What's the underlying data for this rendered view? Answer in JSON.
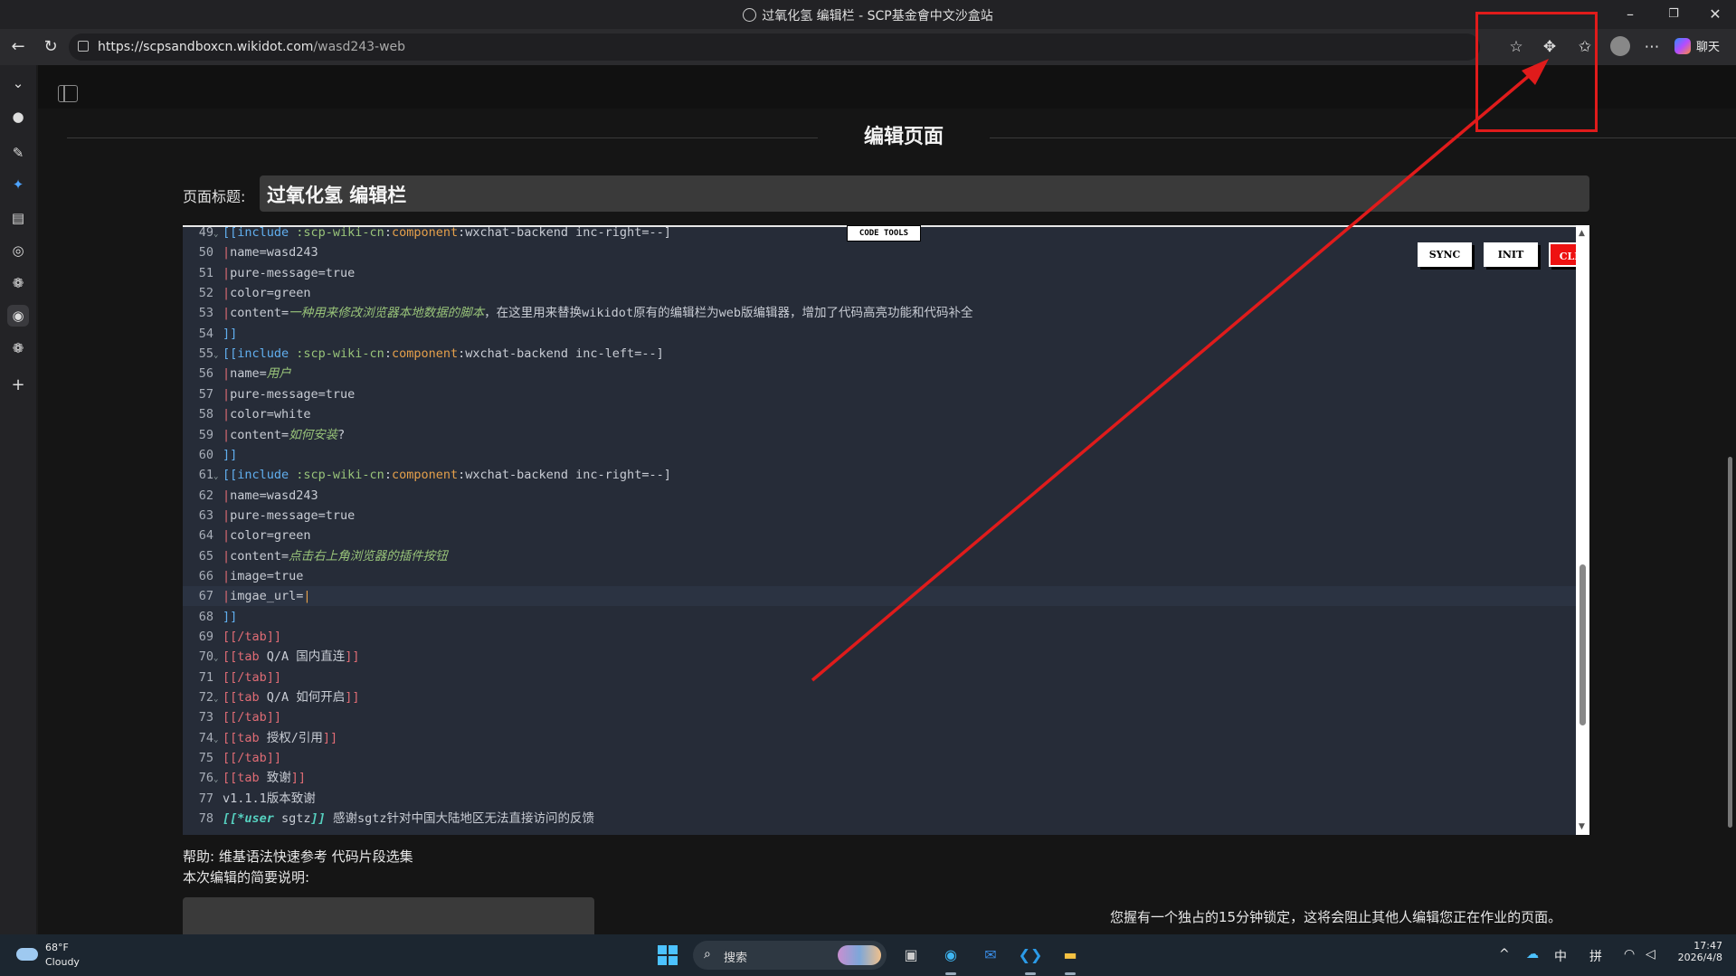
{
  "window": {
    "title": "过氧化氢 编辑栏 - SCP基金會中文沙盒站",
    "controls": {
      "minimize": "–",
      "restore": "❐",
      "close": "✕"
    }
  },
  "browser": {
    "url_host": "https://scpsandboxcn.wikidot.com",
    "url_path": "/wasd243-web",
    "copilot_label": "聊天",
    "icons": [
      "back-icon",
      "refresh-icon",
      "star-icon",
      "extensions-icon",
      "favorites-icon",
      "profile-icon",
      "more-icon"
    ]
  },
  "sidebar": {
    "icons": [
      "chevron-down-icon",
      "github-icon",
      "tool-icon",
      "sparkle-icon",
      "calendar-icon",
      "compass-icon",
      "openai-icon",
      "edge-icon",
      "openai-icon-2",
      "add-icon"
    ]
  },
  "page": {
    "heading": "编辑页面",
    "title_label": "页面标题:",
    "title_value": "过氧化氢 编辑栏",
    "help_text": "帮助: 维基语法快速参考 代码片段选集",
    "summary_label": "本次编辑的简要说明:",
    "lock_message": "您握有一个独占的15分钟锁定，这将会阻止其他人编辑您正在作业的页面。"
  },
  "editor": {
    "code_tools_label": "CODE TOOLS",
    "buttons": {
      "sync": "SYNC",
      "init": "INIT",
      "clear": "CLEAR"
    },
    "lines": [
      {
        "n": "49",
        "fold": true,
        "segs": [
          [
            "k-br",
            "[[include "
          ],
          [
            "k-grn",
            ":scp-wiki-cn"
          ],
          [
            "k-txt",
            ":"
          ],
          [
            "k-org",
            "component"
          ],
          [
            "k-txt",
            ":wxchat-backend inc-right=--]"
          ]
        ]
      },
      {
        "n": "50",
        "fold": false,
        "segs": [
          [
            "pipe",
            "|"
          ],
          [
            "k-txt",
            "name=wasd243"
          ]
        ]
      },
      {
        "n": "51",
        "fold": false,
        "segs": [
          [
            "pipe",
            "|"
          ],
          [
            "k-txt",
            "pure-message=true"
          ]
        ]
      },
      {
        "n": "52",
        "fold": false,
        "segs": [
          [
            "pipe",
            "|"
          ],
          [
            "k-txt",
            "color=green"
          ]
        ]
      },
      {
        "n": "53",
        "fold": false,
        "segs": [
          [
            "pipe",
            "|"
          ],
          [
            "k-txt",
            "content="
          ],
          [
            "k-it",
            "一种用来修改浏览器本地数据的脚本"
          ],
          [
            "k-txt",
            "，在这里用来替换wikidot原有的编辑栏为web版编辑器，增加了代码高亮功能和代码补全"
          ]
        ]
      },
      {
        "n": "54",
        "fold": false,
        "segs": [
          [
            "k-br",
            "]]"
          ]
        ]
      },
      {
        "n": "55",
        "fold": true,
        "segs": [
          [
            "k-br",
            "[[include "
          ],
          [
            "k-grn",
            ":scp-wiki-cn"
          ],
          [
            "k-txt",
            ":"
          ],
          [
            "k-org",
            "component"
          ],
          [
            "k-txt",
            ":wxchat-backend inc-left=--]"
          ]
        ]
      },
      {
        "n": "56",
        "fold": false,
        "segs": [
          [
            "pipe",
            "|"
          ],
          [
            "k-txt",
            "name="
          ],
          [
            "k-it",
            "用户"
          ]
        ]
      },
      {
        "n": "57",
        "fold": false,
        "segs": [
          [
            "pipe",
            "|"
          ],
          [
            "k-txt",
            "pure-message=true"
          ]
        ]
      },
      {
        "n": "58",
        "fold": false,
        "segs": [
          [
            "pipe",
            "|"
          ],
          [
            "k-txt",
            "color=white"
          ]
        ]
      },
      {
        "n": "59",
        "fold": false,
        "segs": [
          [
            "pipe",
            "|"
          ],
          [
            "k-txt",
            "content="
          ],
          [
            "k-it",
            "如何安装"
          ],
          [
            "k-txt",
            "?"
          ]
        ]
      },
      {
        "n": "60",
        "fold": false,
        "segs": [
          [
            "k-br",
            "]]"
          ]
        ]
      },
      {
        "n": "61",
        "fold": true,
        "segs": [
          [
            "k-br",
            "[[include "
          ],
          [
            "k-grn",
            ":scp-wiki-cn"
          ],
          [
            "k-txt",
            ":"
          ],
          [
            "k-org",
            "component"
          ],
          [
            "k-txt",
            ":wxchat-backend inc-right=--]"
          ]
        ]
      },
      {
        "n": "62",
        "fold": false,
        "segs": [
          [
            "pipe",
            "|"
          ],
          [
            "k-txt",
            "name=wasd243"
          ]
        ]
      },
      {
        "n": "63",
        "fold": false,
        "segs": [
          [
            "pipe",
            "|"
          ],
          [
            "k-txt",
            "pure-message=true"
          ]
        ]
      },
      {
        "n": "64",
        "fold": false,
        "segs": [
          [
            "pipe",
            "|"
          ],
          [
            "k-txt",
            "color=green"
          ]
        ]
      },
      {
        "n": "65",
        "fold": false,
        "segs": [
          [
            "pipe",
            "|"
          ],
          [
            "k-txt",
            "content="
          ],
          [
            "k-it",
            "点击右上角浏览器的插件按钮"
          ]
        ]
      },
      {
        "n": "66",
        "fold": false,
        "segs": [
          [
            "pipe",
            "|"
          ],
          [
            "k-txt",
            "image=true"
          ]
        ]
      },
      {
        "n": "67",
        "fold": false,
        "segs": [
          [
            "pipe",
            "|"
          ],
          [
            "k-txt",
            "imgae_url="
          ],
          [
            "k-org",
            "|"
          ]
        ]
      },
      {
        "n": "68",
        "fold": false,
        "segs": [
          [
            "k-br",
            "]]"
          ]
        ]
      },
      {
        "n": "69",
        "fold": false,
        "segs": [
          [
            "k-red",
            "[[/tab]]"
          ]
        ]
      },
      {
        "n": "70",
        "fold": true,
        "segs": [
          [
            "k-red",
            "[[tab "
          ],
          [
            "k-txt",
            "Q/A 国内直连"
          ],
          [
            "k-red",
            "]]"
          ]
        ]
      },
      {
        "n": "71",
        "fold": false,
        "segs": [
          [
            "k-red",
            "[[/tab]]"
          ]
        ]
      },
      {
        "n": "72",
        "fold": true,
        "segs": [
          [
            "k-red",
            "[[tab "
          ],
          [
            "k-txt",
            "Q/A 如何开启"
          ],
          [
            "k-red",
            "]]"
          ]
        ]
      },
      {
        "n": "73",
        "fold": false,
        "segs": [
          [
            "k-red",
            "[[/tab]]"
          ]
        ]
      },
      {
        "n": "74",
        "fold": true,
        "segs": [
          [
            "k-red",
            "[[tab "
          ],
          [
            "k-txt",
            "授权/引用"
          ],
          [
            "k-red",
            "]]"
          ]
        ]
      },
      {
        "n": "75",
        "fold": false,
        "segs": [
          [
            "k-red",
            "[[/tab]]"
          ]
        ]
      },
      {
        "n": "76",
        "fold": true,
        "segs": [
          [
            "k-red",
            "[[tab "
          ],
          [
            "k-txt",
            "致谢"
          ],
          [
            "k-red",
            "]]"
          ]
        ]
      },
      {
        "n": "77",
        "fold": false,
        "segs": [
          [
            "k-txt",
            "v1.1.1版本致谢"
          ]
        ]
      },
      {
        "n": "78",
        "fold": false,
        "segs": [
          [
            "k-cy",
            "[[*user "
          ],
          [
            "k-txt",
            "sgtz"
          ],
          [
            "k-cy",
            "]]"
          ],
          [
            "k-txt",
            " 感谢sgtz针对中国大陆地区无法直接访问的反馈"
          ]
        ]
      }
    ],
    "active_line": "67"
  },
  "taskbar": {
    "weather_temp": "68°F",
    "weather_cond": "Cloudy",
    "search_label": "搜索",
    "apps": [
      "task-view-icon",
      "edge-icon",
      "outlook-icon",
      "vscode-icon",
      "file-explorer-icon"
    ],
    "tray": {
      "chevron": "^",
      "ime_lang": "中",
      "ime_mode": "拼"
    },
    "time": "17:47",
    "date": "2026/4/8"
  },
  "annotation": {
    "color": "#e01b1b"
  }
}
